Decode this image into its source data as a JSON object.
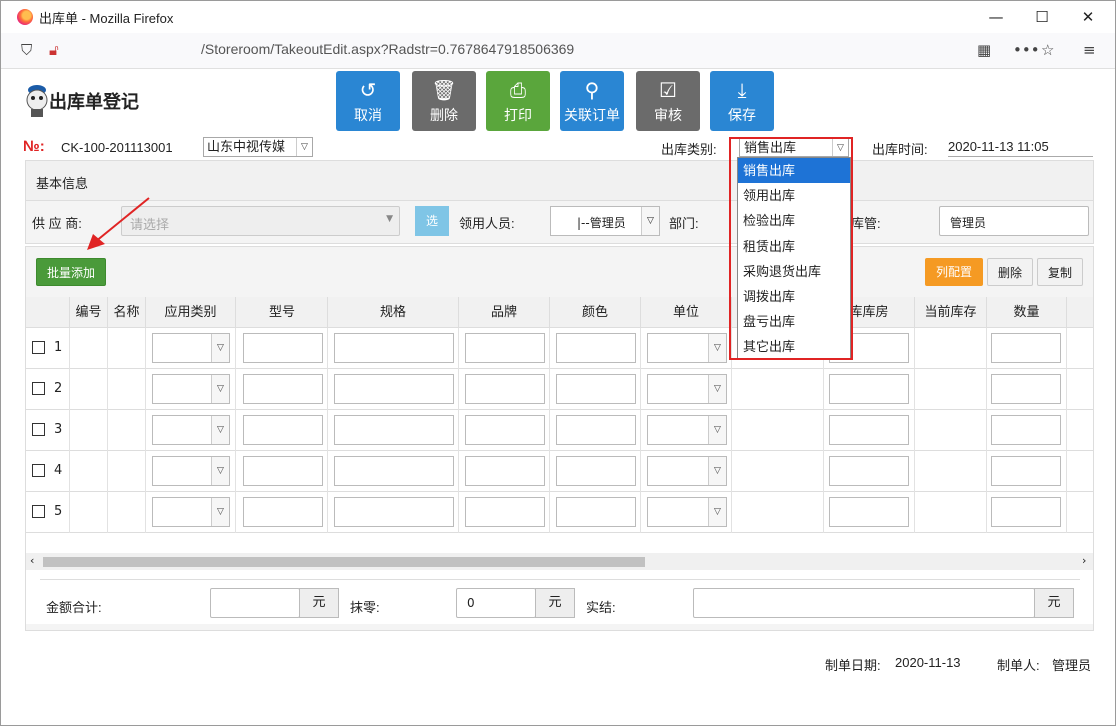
{
  "window": {
    "title": "出库单 - Mozilla Firefox",
    "url": "/Storeroom/TakeoutEdit.aspx?Radstr=0.7678647918506369"
  },
  "header": {
    "title": "出库单登记"
  },
  "toolbar": {
    "cancel": "取消",
    "delete": "删除",
    "print": "打印",
    "link_order": "关联订单",
    "review": "审核",
    "save": "保存"
  },
  "order": {
    "no_label": "№:",
    "no_value": "CK-100-201113001",
    "company": "山东中视传媒",
    "type_label": "出库类别:",
    "type_value": "销售出库",
    "time_label": "出库时间:",
    "time_value": "2020-11-13 11:05"
  },
  "dropdown": {
    "options": [
      "销售出库",
      "领用出库",
      "检验出库",
      "租赁出库",
      "采购退货出库",
      "调拨出库",
      "盘亏出库",
      "其它出库"
    ],
    "selected_index": 0
  },
  "basic": {
    "section_title": "基本信息",
    "supplier_label": "供 应 商:",
    "supplier_placeholder": "请选择",
    "select_btn": "选",
    "recipient_label": "领用人员:",
    "recipient_value": "|--管理员",
    "dept_label": "部门:",
    "keeper_label": "库管:",
    "keeper_value": "管理员"
  },
  "items": {
    "batch_add": "批量添加",
    "col_config": "列配置",
    "delete": "删除",
    "copy": "复制",
    "columns": [
      "编号",
      "名称",
      "应用类别",
      "型号",
      "规格",
      "品牌",
      "颜色",
      "单位",
      "",
      "库库房",
      "当前库存",
      "数量"
    ],
    "rows": [
      "1",
      "2",
      "3",
      "4",
      "5"
    ]
  },
  "totals": {
    "amount_label": "金额合计:",
    "amount_unit": "元",
    "rounding_label": "抹零:",
    "rounding_value": "0",
    "rounding_unit": "元",
    "actual_label": "实结:",
    "actual_unit": "元"
  },
  "footer": {
    "date_label": "制单日期:",
    "date_value": "2020-11-13",
    "maker_label": "制单人:",
    "maker_value": "管理员"
  },
  "colors": {
    "primary": "#2a86d3",
    "green": "#5aa63c",
    "gray": "#6b6b6b",
    "orange": "#f59a23",
    "highlight_red": "#e02424"
  }
}
